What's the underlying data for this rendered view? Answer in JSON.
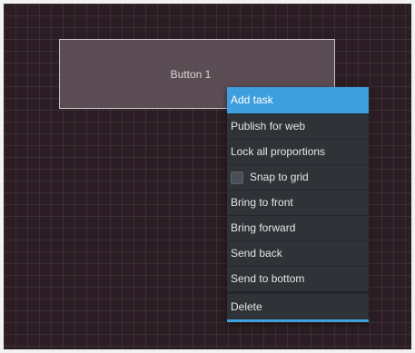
{
  "canvas": {
    "widget": {
      "label": "Button 1"
    }
  },
  "context_menu": {
    "items": [
      {
        "label": "Add task"
      },
      {
        "label": "Publish for web"
      },
      {
        "label": "Lock all proportions"
      },
      {
        "label": "Snap to grid",
        "checked": false
      },
      {
        "label": "Bring to front"
      },
      {
        "label": "Bring forward"
      },
      {
        "label": "Send back"
      },
      {
        "label": "Send to bottom"
      },
      {
        "label": "Delete"
      }
    ]
  },
  "colors": {
    "canvas_background": "#2b1d23",
    "menu_background": "#2f3338",
    "accent": "#3e9fdf"
  }
}
